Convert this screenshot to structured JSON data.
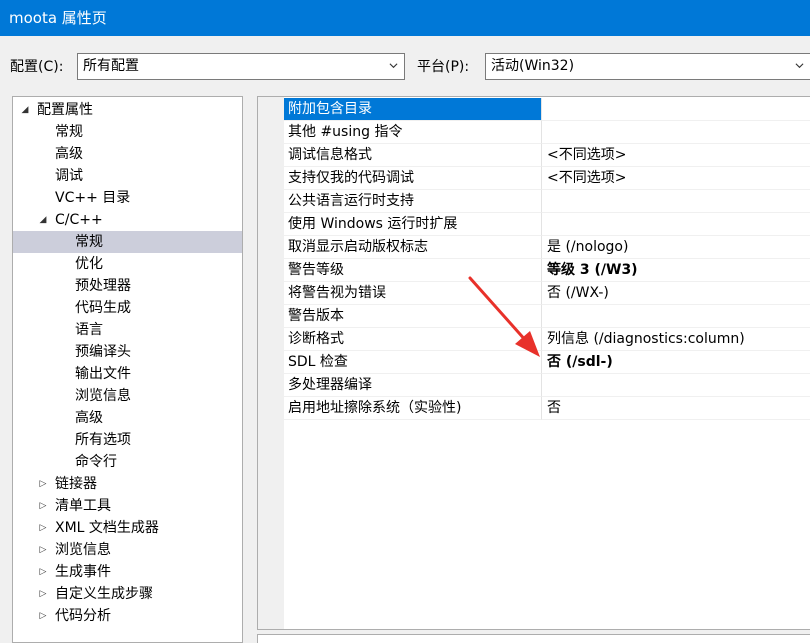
{
  "window": {
    "title": "moota 属性页"
  },
  "toolbar": {
    "config_label": "配置(C):",
    "config_value": "所有配置",
    "platform_label": "平台(P):",
    "platform_value": "活动(Win32)"
  },
  "tree": [
    {
      "label": "配置属性",
      "level": 0,
      "expander": "expanded"
    },
    {
      "label": "常规",
      "level": 1
    },
    {
      "label": "高级",
      "level": 1
    },
    {
      "label": "调试",
      "level": 1
    },
    {
      "label": "VC++ 目录",
      "level": 1
    },
    {
      "label": "C/C++",
      "level": 1,
      "expander": "expanded"
    },
    {
      "label": "常规",
      "level": 2,
      "selected": true
    },
    {
      "label": "优化",
      "level": 2
    },
    {
      "label": "预处理器",
      "level": 2
    },
    {
      "label": "代码生成",
      "level": 2
    },
    {
      "label": "语言",
      "level": 2
    },
    {
      "label": "预编译头",
      "level": 2
    },
    {
      "label": "输出文件",
      "level": 2
    },
    {
      "label": "浏览信息",
      "level": 2
    },
    {
      "label": "高级",
      "level": 2
    },
    {
      "label": "所有选项",
      "level": 2
    },
    {
      "label": "命令行",
      "level": 2
    },
    {
      "label": "链接器",
      "level": 1,
      "expander": "collapsed"
    },
    {
      "label": "清单工具",
      "level": 1,
      "expander": "collapsed"
    },
    {
      "label": "XML 文档生成器",
      "level": 1,
      "expander": "collapsed"
    },
    {
      "label": "浏览信息",
      "level": 1,
      "expander": "collapsed"
    },
    {
      "label": "生成事件",
      "level": 1,
      "expander": "collapsed"
    },
    {
      "label": "自定义生成步骤",
      "level": 1,
      "expander": "collapsed"
    },
    {
      "label": "代码分析",
      "level": 1,
      "expander": "collapsed"
    }
  ],
  "properties": [
    {
      "name": "附加包含目录",
      "value": "",
      "selected": true
    },
    {
      "name": "其他 #using 指令",
      "value": ""
    },
    {
      "name": "调试信息格式",
      "value": "<不同选项>"
    },
    {
      "name": "支持仅我的代码调试",
      "value": "<不同选项>"
    },
    {
      "name": "公共语言运行时支持",
      "value": ""
    },
    {
      "name": "使用 Windows 运行时扩展",
      "value": ""
    },
    {
      "name": "取消显示启动版权标志",
      "value": "是 (/nologo)"
    },
    {
      "name": "警告等级",
      "value": "等级 3 (/W3)",
      "bold": true
    },
    {
      "name": "将警告视为错误",
      "value": "否 (/WX-)"
    },
    {
      "name": "警告版本",
      "value": ""
    },
    {
      "name": "诊断格式",
      "value": "列信息 (/diagnostics:column)"
    },
    {
      "name": "SDL 检查",
      "value": "否 (/sdl-)",
      "bold": true
    },
    {
      "name": "多处理器编译",
      "value": ""
    },
    {
      "name": "启用地址擦除系统（实验性)",
      "value": "否"
    }
  ],
  "colors": {
    "accent": "#0078d7",
    "tree_selection": "#cccedb",
    "annotation_arrow": "#e8312a"
  }
}
